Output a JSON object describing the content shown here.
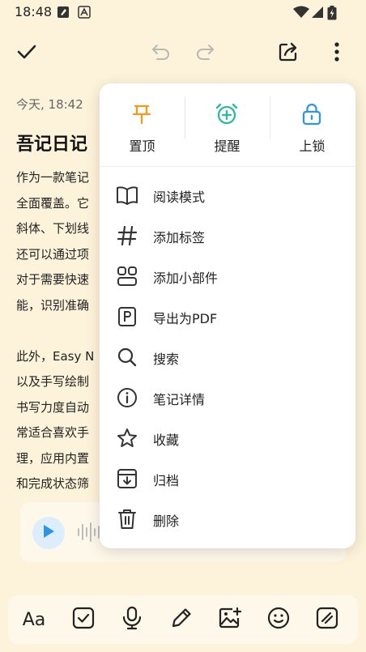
{
  "status_bar": {
    "time": "18:48"
  },
  "note": {
    "date": "今天, 18:42",
    "title": "吾记日记",
    "body_lines": [
      "作为一款笔记",
      "全面覆盖。它",
      "斜体、下划线",
      "还可以通过项",
      "对于需要快速",
      "能，识别准确",
      "",
      "此外，Easy N",
      "以及手写绘制",
      "书写力度自动",
      "常适合喜欢手",
      "理，应用内置",
      "和完成状态筛"
    ]
  },
  "menu": {
    "quick_actions": [
      {
        "label": "置顶",
        "icon": "pin-icon",
        "color": "#F39A1E"
      },
      {
        "label": "提醒",
        "icon": "alarm-add-icon",
        "color": "#2BB9A0"
      },
      {
        "label": "上锁",
        "icon": "lock-icon",
        "color": "#2F95E0"
      }
    ],
    "items": [
      {
        "label": "阅读模式",
        "icon": "book-open-icon"
      },
      {
        "label": "添加标签",
        "icon": "hashtag-icon"
      },
      {
        "label": "添加小部件",
        "icon": "widgets-icon"
      },
      {
        "label": "导出为PDF",
        "icon": "pdf-export-icon"
      },
      {
        "label": "搜索",
        "icon": "search-icon"
      },
      {
        "label": "笔记详情",
        "icon": "info-icon"
      },
      {
        "label": "收藏",
        "icon": "star-icon"
      },
      {
        "label": "归档",
        "icon": "archive-icon"
      },
      {
        "label": "删除",
        "icon": "trash-icon"
      }
    ]
  },
  "bottom_toolbar": {
    "text_format_label": "Aa"
  },
  "colors": {
    "background": "#FDF2DA",
    "accent": "#2F95E0"
  }
}
